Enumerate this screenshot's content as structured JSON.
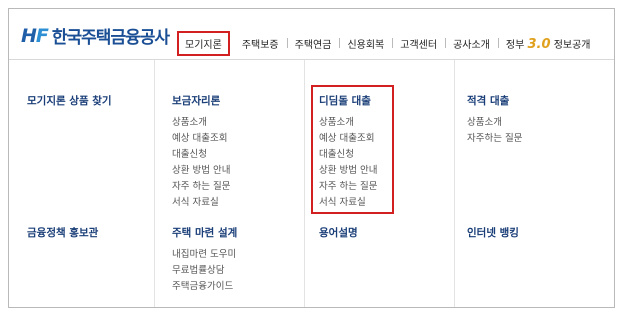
{
  "header": {
    "logo_mark": "HF",
    "logo_text": "한국주택금융공사",
    "nav": [
      {
        "label": "모기지론"
      },
      {
        "label": "주택보증"
      },
      {
        "label": "주택연금"
      },
      {
        "label": "신용회복"
      },
      {
        "label": "고객센터"
      },
      {
        "label": "공사소개"
      }
    ],
    "gov3": {
      "prefix": "정부",
      "num": "3.0",
      "suffix": "정보공개"
    }
  },
  "menu": {
    "col1": {
      "title_top": "모기지론 상품 찾기",
      "title_bottom": "금융정책 홍보관"
    },
    "col2": {
      "title_top": "보금자리론",
      "items_top": [
        "상품소개",
        "예상 대출조회",
        "대출신청",
        "상환 방법 안내",
        "자주 하는 질문",
        "서식 자료실"
      ],
      "title_bottom": "주택 마련 설계",
      "items_bottom": [
        "내집마련 도우미",
        "무료법률상담",
        "주택금융가이드"
      ]
    },
    "col3": {
      "title_top": "디딤돌 대출",
      "items_top": [
        "상품소개",
        "예상 대출조회",
        "대출신청",
        "상환 방법 안내",
        "자주 하는 질문",
        "서식 자료실"
      ],
      "title_bottom": "용어설명"
    },
    "col4": {
      "title_top": "적격 대출",
      "items_top": [
        "상품소개",
        "자주하는 질문"
      ],
      "title_bottom": "인터넷 뱅킹"
    }
  },
  "colors": {
    "highlight": "#d21f1f",
    "brand": "#1b4f95"
  }
}
